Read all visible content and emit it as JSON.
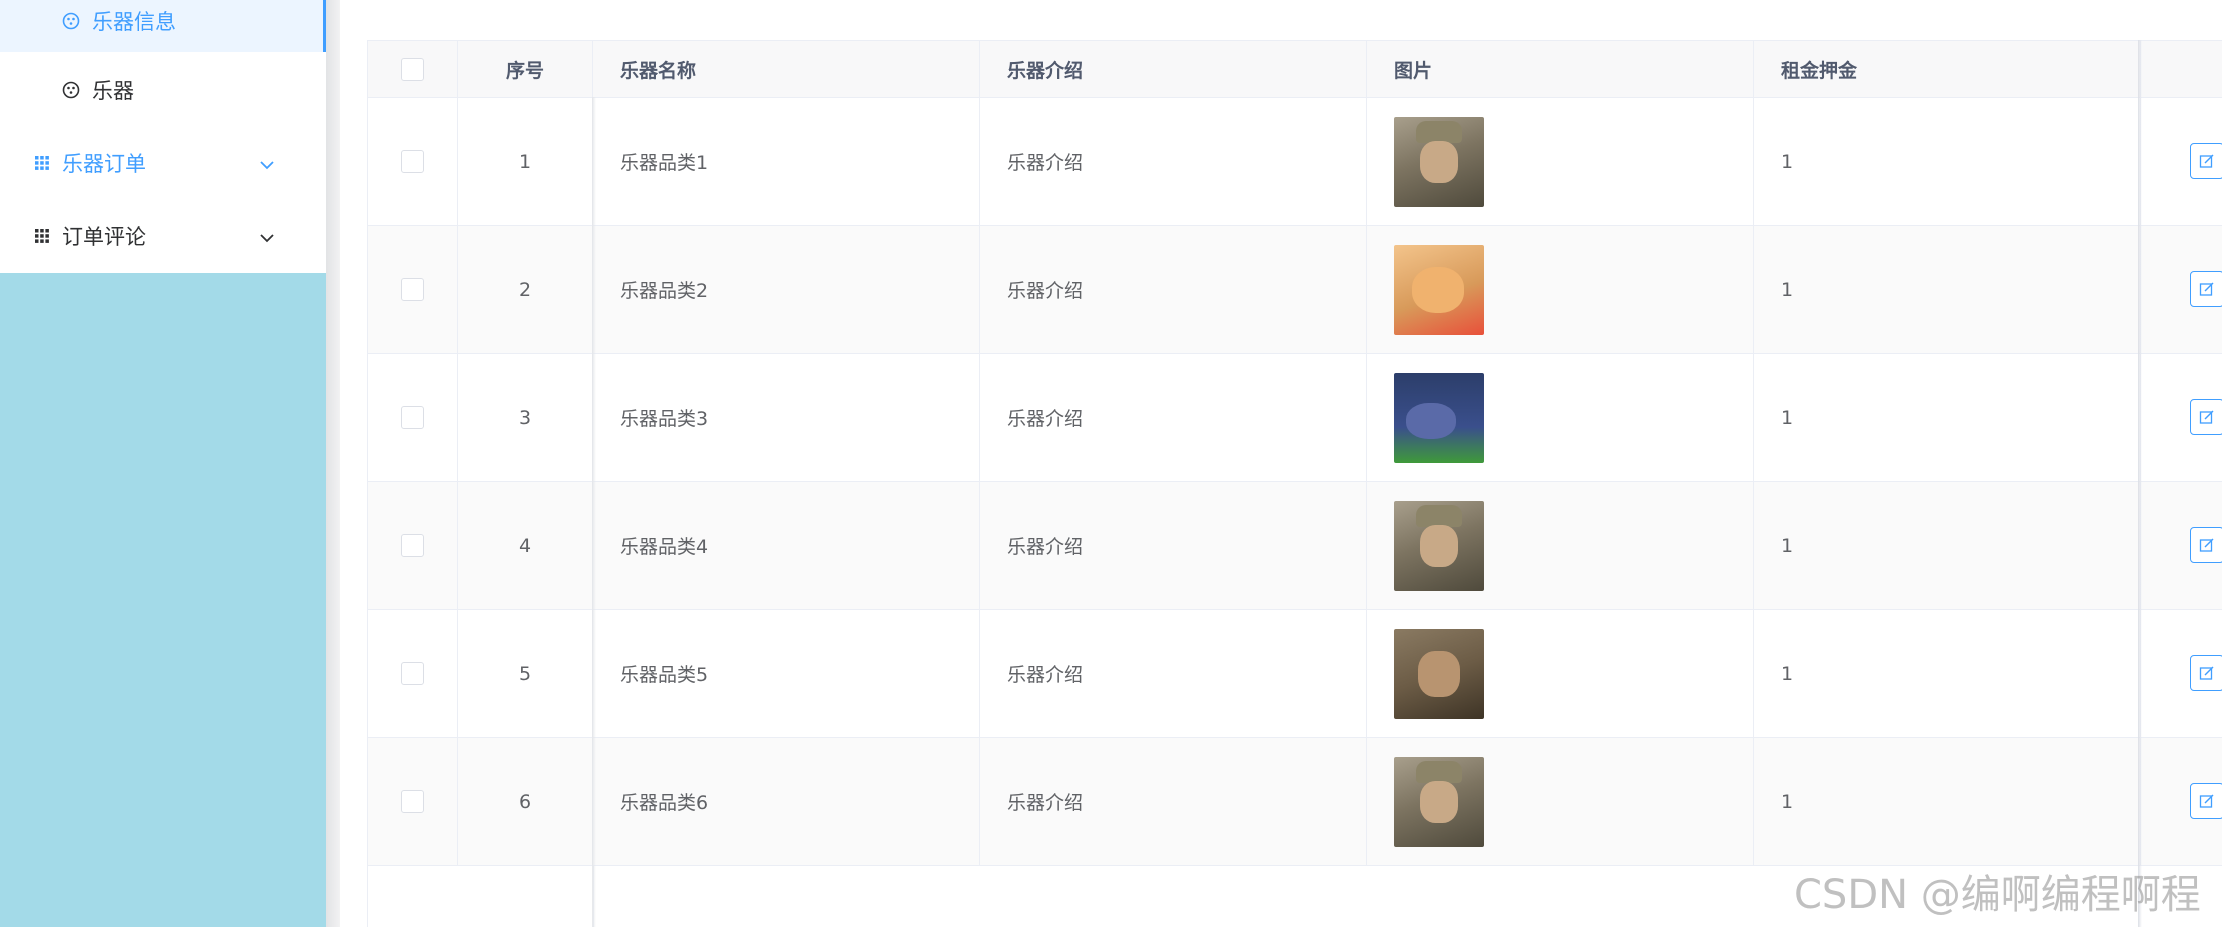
{
  "sidebar": {
    "items": [
      {
        "label": "乐器信息",
        "icon": "instrument-icon",
        "state": "active"
      },
      {
        "label": "乐器",
        "icon": "instrument-icon",
        "state": "normal"
      },
      {
        "label": "乐器订单",
        "icon": "grid-icon",
        "state": "expandable"
      },
      {
        "label": "订单评论",
        "icon": "grid-icon",
        "state": "expandable"
      }
    ]
  },
  "table": {
    "headers": {
      "index": "序号",
      "name": "乐器名称",
      "description": "乐器介绍",
      "image": "图片",
      "deposit": "租金押金"
    },
    "rows": [
      {
        "index": "1",
        "name": "乐器品类1",
        "description": "乐器介绍",
        "image": "soldier-photo",
        "deposit": "1"
      },
      {
        "index": "2",
        "name": "乐器品类2",
        "description": "乐器介绍",
        "image": "cat-photo",
        "deposit": "1"
      },
      {
        "index": "3",
        "name": "乐器品类3",
        "description": "乐器介绍",
        "image": "cartoon-photo",
        "deposit": "1"
      },
      {
        "index": "4",
        "name": "乐器品类4",
        "description": "乐器介绍",
        "image": "soldier-photo",
        "deposit": "1"
      },
      {
        "index": "5",
        "name": "乐器品类5",
        "description": "乐器介绍",
        "image": "shouting-soldier-photo",
        "deposit": "1"
      },
      {
        "index": "6",
        "name": "乐器品类6",
        "description": "乐器介绍",
        "image": "soldier-photo",
        "deposit": "1"
      }
    ]
  },
  "colors": {
    "accent": "#409eff",
    "sidebar_bg": "#a3dae8",
    "text": "#606266"
  },
  "watermark": "CSDN @编啊编程啊程"
}
